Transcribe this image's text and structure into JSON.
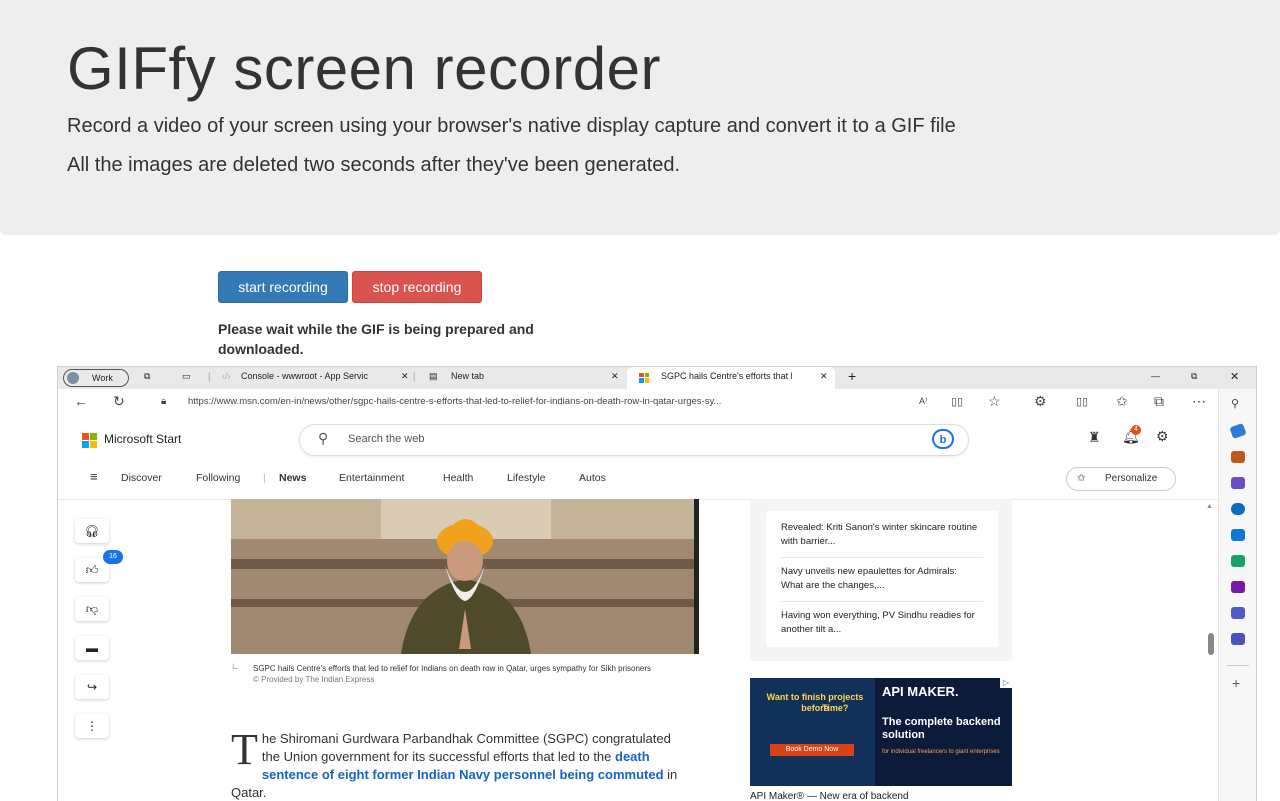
{
  "jumbotron": {
    "title": "GIFfy screen recorder",
    "subtitle": "Record a video of your screen using your browser's native display capture and convert it to a GIF file",
    "note": "All the images are deleted two seconds after they've been generated."
  },
  "controls": {
    "start_label": "start recording",
    "stop_label": "stop recording",
    "status": "Please wait while the GIF is being prepared and downloaded."
  },
  "browser": {
    "profile_label": "Work",
    "tabs": [
      {
        "label": "Console - wwwroot - App Servic"
      },
      {
        "label": "New tab"
      },
      {
        "label": "SGPC hails Centre's efforts that l"
      }
    ],
    "url": "https://www.msn.com/en-in/news/other/sgpc-hails-centre-s-efforts-that-led-to-relief-for-indians-on-death-row-in-qatar-urges-sy...",
    "new_tab": "+"
  },
  "msn": {
    "brand": "Microsoft Start",
    "search_placeholder": "Search the web",
    "notification_count": "4",
    "nav": [
      "Discover",
      "Following",
      "News",
      "Entertainment",
      "Health",
      "Lifestyle",
      "Autos"
    ],
    "personalize": "Personalize",
    "like_count": "16",
    "caption": "SGPC hails Centre's efforts that led to relief for Indians on death row in Qatar, urges sympathy for Sikh prisoners",
    "provider": "© Provided by The Indian Express",
    "article": {
      "drop_cap": "T",
      "text_start": "he Shiromani Gurdwara Parbandhak Committee (SGPC) congratulated the Union government for its successful efforts that led to the ",
      "link": "death sentence of eight former Indian Navy personnel being commuted",
      "text_end": " in Qatar."
    },
    "related": [
      "Revealed: Kriti Sanon's winter skincare routine with barrier...",
      "Navy unveils new epaulettes for Admirals: What are the changes,...",
      "Having won everything, PV Sindhu readies for another tilt a..."
    ],
    "ad": {
      "left_top": "Want to finish projects before",
      "left_time": "Time?",
      "cta": "Book Demo Now",
      "brand": "API MAKER.",
      "headline": "The complete backend solution",
      "sub": "for individual freelancers to giant enterprises",
      "footer": "API Maker® — New era of backend"
    }
  }
}
